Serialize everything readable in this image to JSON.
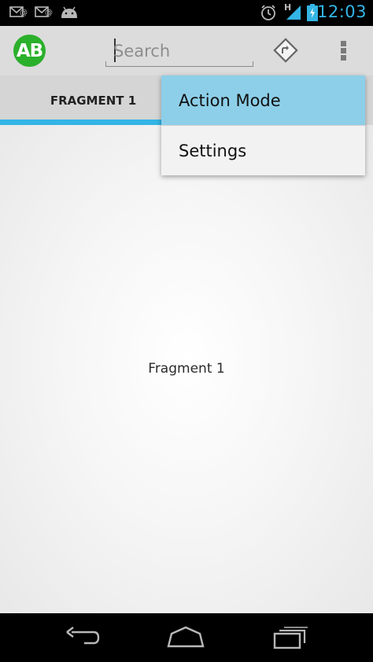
{
  "status_bar": {
    "time": "12:03",
    "network_type": "H",
    "icons": [
      "email-notification-icon",
      "email-notification-icon",
      "android-debug-icon",
      "alarm-icon",
      "signal-icon",
      "battery-charging-icon"
    ],
    "accent_color": "#33b5e5"
  },
  "action_bar": {
    "logo_text": "AB",
    "logo_color": "#2bb02b",
    "search": {
      "placeholder": "Search",
      "value": ""
    },
    "actions": [
      "directions-icon",
      "overflow-menu-icon"
    ]
  },
  "tabs": [
    {
      "label": "FRAGMENT 1",
      "selected": true
    }
  ],
  "tab_indicator_color": "#33b5e5",
  "overflow_menu": {
    "items": [
      {
        "label": "Action Mode",
        "highlighted": true
      },
      {
        "label": "Settings",
        "highlighted": false
      }
    ],
    "highlight_color": "#8dcfe9"
  },
  "content": {
    "label": "Fragment 1"
  },
  "nav_bar": {
    "buttons": [
      "back-icon",
      "home-icon",
      "recent-apps-icon"
    ]
  }
}
